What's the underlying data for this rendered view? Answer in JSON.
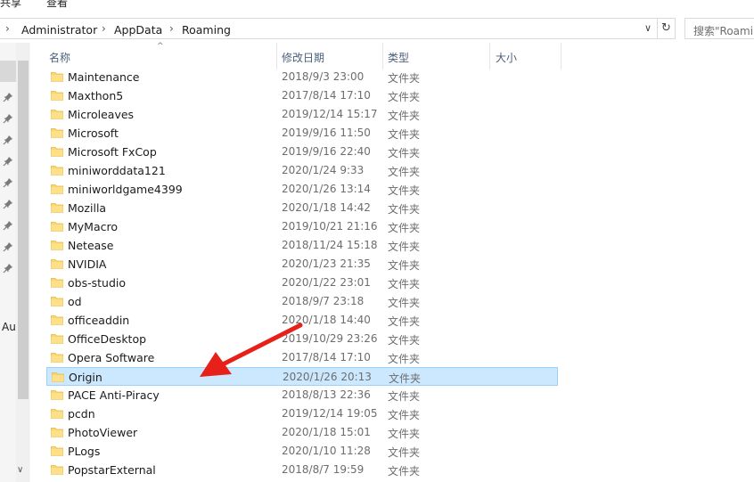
{
  "ribbon": {
    "share_tab": "共享",
    "view_tab": "查看"
  },
  "address": {
    "crumbs": [
      "Administrator",
      "AppData",
      "Roaming"
    ],
    "search_placeholder": "搜索\"Roaming\""
  },
  "nav_pane": {
    "partial_label": "Au"
  },
  "columns": {
    "name": "名称",
    "date": "修改日期",
    "type": "类型",
    "size": "大小"
  },
  "files": [
    {
      "name": "Maintenance",
      "date": "2018/9/3 23:00",
      "type": "文件夹"
    },
    {
      "name": "Maxthon5",
      "date": "2017/8/14 17:10",
      "type": "文件夹"
    },
    {
      "name": "Microleaves",
      "date": "2019/12/14 15:17",
      "type": "文件夹"
    },
    {
      "name": "Microsoft",
      "date": "2019/9/16 11:50",
      "type": "文件夹"
    },
    {
      "name": "Microsoft FxCop",
      "date": "2019/9/16 22:40",
      "type": "文件夹"
    },
    {
      "name": "miniworddata121",
      "date": "2020/1/24 9:33",
      "type": "文件夹"
    },
    {
      "name": "miniworldgame4399",
      "date": "2020/1/26 13:14",
      "type": "文件夹"
    },
    {
      "name": "Mozilla",
      "date": "2020/1/18 14:42",
      "type": "文件夹"
    },
    {
      "name": "MyMacro",
      "date": "2019/10/21 21:16",
      "type": "文件夹"
    },
    {
      "name": "Netease",
      "date": "2018/11/24 15:18",
      "type": "文件夹"
    },
    {
      "name": "NVIDIA",
      "date": "2020/1/23 21:35",
      "type": "文件夹"
    },
    {
      "name": "obs-studio",
      "date": "2020/1/22 23:01",
      "type": "文件夹"
    },
    {
      "name": "od",
      "date": "2018/9/7 23:18",
      "type": "文件夹"
    },
    {
      "name": "officeaddin",
      "date": "2020/1/18 14:40",
      "type": "文件夹"
    },
    {
      "name": "OfficeDesktop",
      "date": "2019/10/29 23:26",
      "type": "文件夹"
    },
    {
      "name": "Opera Software",
      "date": "2017/8/14 17:10",
      "type": "文件夹"
    },
    {
      "name": "Origin",
      "date": "2020/1/26 20:13",
      "type": "文件夹",
      "selected": true
    },
    {
      "name": "PACE Anti-Piracy",
      "date": "2018/8/13 22:36",
      "type": "文件夹"
    },
    {
      "name": "pcdn",
      "date": "2019/12/14 19:05",
      "type": "文件夹"
    },
    {
      "name": "PhotoViewer",
      "date": "2020/1/18 15:01",
      "type": "文件夹"
    },
    {
      "name": "PLogs",
      "date": "2020/1/10 11:28",
      "type": "文件夹"
    },
    {
      "name": "PopstarExternal",
      "date": "2018/8/7 19:59",
      "type": "文件夹"
    }
  ],
  "colors": {
    "selection_bg": "#cce8ff",
    "selection_border": "#99d1ff",
    "folder": "#ffd767",
    "annotation_arrow": "#e8201a"
  }
}
